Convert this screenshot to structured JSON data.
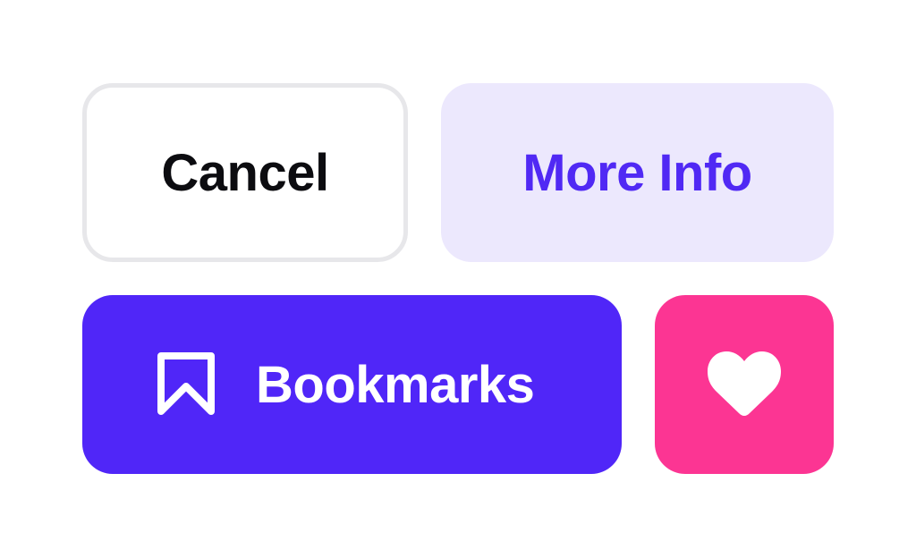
{
  "buttons": {
    "cancel": {
      "label": "Cancel"
    },
    "more_info": {
      "label": "More Info"
    },
    "bookmarks": {
      "label": "Bookmarks",
      "icon": "bookmark-icon"
    },
    "favorite": {
      "icon": "heart-icon"
    }
  },
  "colors": {
    "cancel_border": "#e7e7ea",
    "cancel_text": "#0c0c10",
    "more_info_bg": "#ece8fd",
    "more_info_text": "#5029f4",
    "bookmarks_bg": "#5026f8",
    "favorite_bg": "#fc3593"
  }
}
